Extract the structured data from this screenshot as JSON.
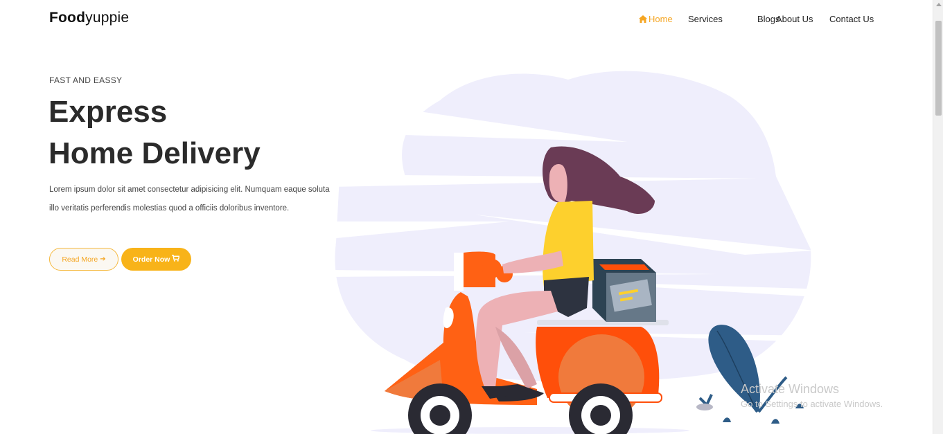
{
  "brand": {
    "bold": "Food",
    "light": "yuppie"
  },
  "nav": {
    "items": [
      {
        "label": "Home",
        "active": true,
        "icon": "home-icon"
      },
      {
        "label": "Services"
      },
      {
        "label": "Blogs"
      },
      {
        "label": "About Us"
      },
      {
        "label": "Contact Us"
      }
    ]
  },
  "hero": {
    "eyebrow": "FAST AND EASSY",
    "headline_line1": "Express",
    "headline_line2": "Home Delivery",
    "description": "Lorem ipsum dolor sit amet consectetur adipisicing elit. Numquam eaque soluta illo veritatis perferendis molestias quod a officiis doloribus inventore.",
    "read_more": "Read More",
    "read_more_icon": "arrow-right-icon",
    "order_now": "Order Now",
    "order_now_icon": "cart-icon"
  },
  "watermark": {
    "title": "Activate Windows",
    "subtitle": "Go to Settings to activate Windows."
  },
  "colors": {
    "accent": "#f8b319",
    "nav_active": "#f5a623",
    "cloud": "#efeefc",
    "scooter": "#ff4f0a",
    "hair": "#6a3b55",
    "shirt": "#fdd02d",
    "plant": "#2e5c87"
  }
}
